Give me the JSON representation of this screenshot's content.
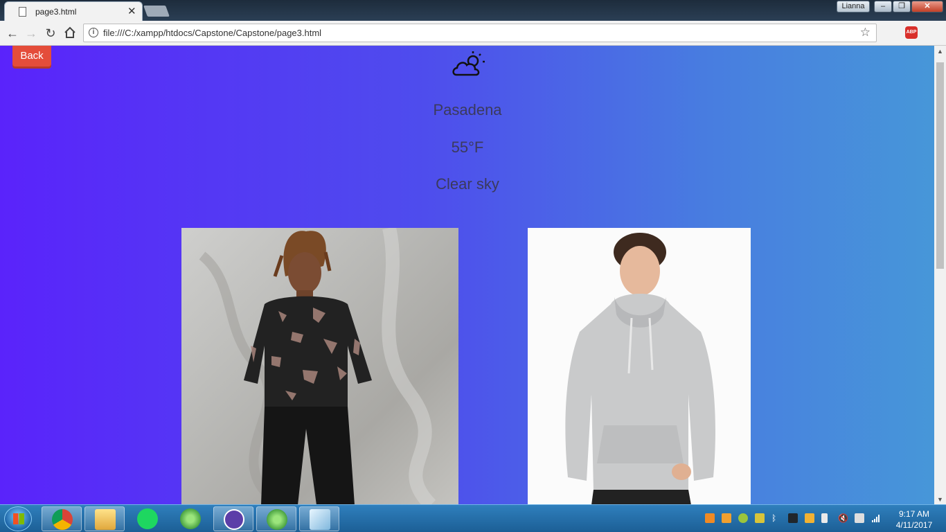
{
  "browser": {
    "tab_title": "page3.html",
    "tab_close": "✕",
    "profile_name": "Lianna",
    "window_min": "–",
    "window_max": "❐",
    "window_close": "✕",
    "url": "file:///C:/xampp/htdocs/Capstone/Capstone/page3.html",
    "extension_label": "ABP"
  },
  "page": {
    "back_label": "Back",
    "weather_icon": "partly-cloudy-icon",
    "city": "Pasadena",
    "temperature": "55°F",
    "condition": "Clear sky",
    "outfits": [
      {
        "name": "outfit-image-1",
        "desc": "bleached black sweatshirt, black jeans"
      },
      {
        "name": "outfit-image-2",
        "desc": "grey hoodie"
      }
    ]
  },
  "taskbar": {
    "apps": [
      "chrome",
      "file-explorer",
      "spotify",
      "atom",
      "github-desktop",
      "atom",
      "notepad"
    ],
    "time": "9:17 AM",
    "date": "4/11/2017"
  },
  "colors": {
    "gradient_start": "#5a23fb",
    "gradient_end": "#4798d8",
    "back_button": "#e44d3a",
    "weather_text": "#3b3a5c"
  }
}
